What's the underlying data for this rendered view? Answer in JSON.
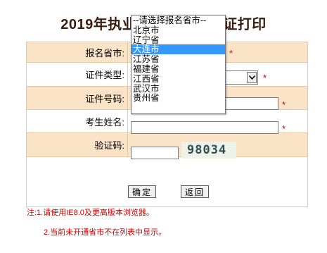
{
  "page": {
    "title": "2019年执业药师考试准考证打印"
  },
  "form": {
    "province_label": "报名省市:",
    "id_type_label": "证件类型:",
    "id_number_label": "证件号码:",
    "name_label": "考生姓名:",
    "captcha_label": "验证码:",
    "required_mark": "*",
    "id_number_value": "",
    "name_value": "",
    "captcha_value": "",
    "captcha_text": "98034"
  },
  "buttons": {
    "confirm": "确定",
    "back": "返回"
  },
  "notes": {
    "line1": "注:1.请使用IE8.0及更高版本浏览器。",
    "line2": "2.当前未开通省市不在列表中显示。"
  },
  "province_dropdown": {
    "selected": "大连市",
    "options": [
      "--请选择报名省市--",
      "北京市",
      "辽宁省",
      "大连市",
      "江苏省",
      "福建省",
      "江西省",
      "武汉市",
      "贵州省"
    ]
  },
  "colors": {
    "row_shade": "#fbe3c7",
    "border": "#e3c9a8",
    "required": "#e00000",
    "note": "#cc0000",
    "selection": "#3399ff",
    "title": "#3a1c0c"
  },
  "icons": {
    "select_arrow": "chevron-down-icon"
  }
}
